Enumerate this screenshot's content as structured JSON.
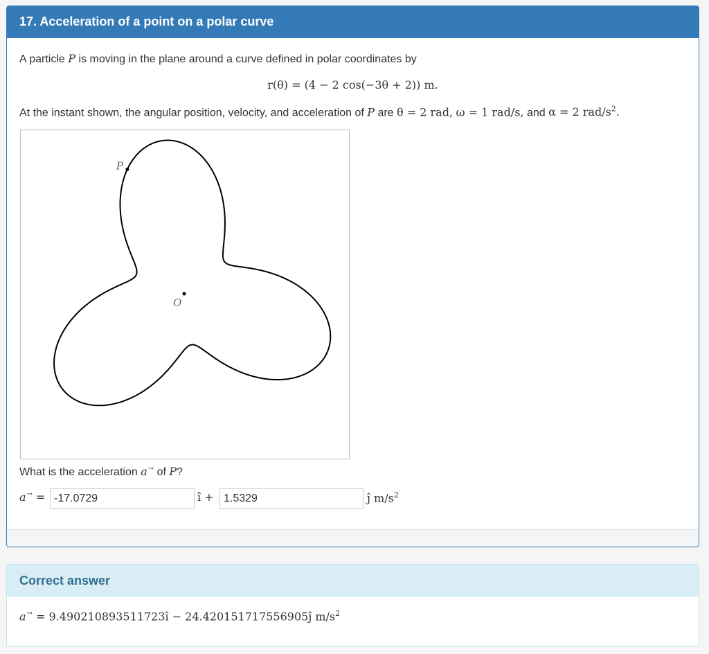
{
  "question": {
    "title": "17. Acceleration of a point on a polar curve",
    "intro_before": "A particle",
    "intro_var": "P",
    "intro_after": "is moving in the plane around a curve defined in polar coordinates by",
    "equation": "r(θ) = (4 − 2 cos(−3θ + 2)) m.",
    "instant": {
      "text1": "At the instant shown, the angular position, velocity, and acceleration of",
      "var": "P",
      "text2": "are",
      "theta": "θ = 2 rad,",
      "omega": "ω = 1 rad/s,",
      "and": "and",
      "alpha": "α = 2 rad/s",
      "alpha_sup": "2",
      "end": "."
    },
    "figure": {
      "point_label": "P",
      "origin_label": "O",
      "curve_a": 4,
      "curve_b": 2,
      "curve_k": -3,
      "curve_c": 2,
      "theta_P": 2
    },
    "prompt_before": "What is the acceleration",
    "prompt_var": "a",
    "prompt_mid": "of",
    "prompt_p": "P",
    "prompt_end": "?",
    "answer": {
      "label_var": "a",
      "label_eq": "=",
      "i_value": "-17.0729",
      "i_unit": "ı̂ +",
      "j_value": "1.5329",
      "j_unit": "ȷ̂ m/s",
      "j_unit_sup": "2"
    }
  },
  "correct": {
    "heading": "Correct answer",
    "var": "a",
    "expr": "= 9.490210893511723ı̂ − 24.420151717556905ȷ̂ m/s",
    "sup": "2"
  },
  "colors": {
    "primary": "#337ab7",
    "info_bg": "#d9edf7",
    "info_text": "#31708f"
  }
}
